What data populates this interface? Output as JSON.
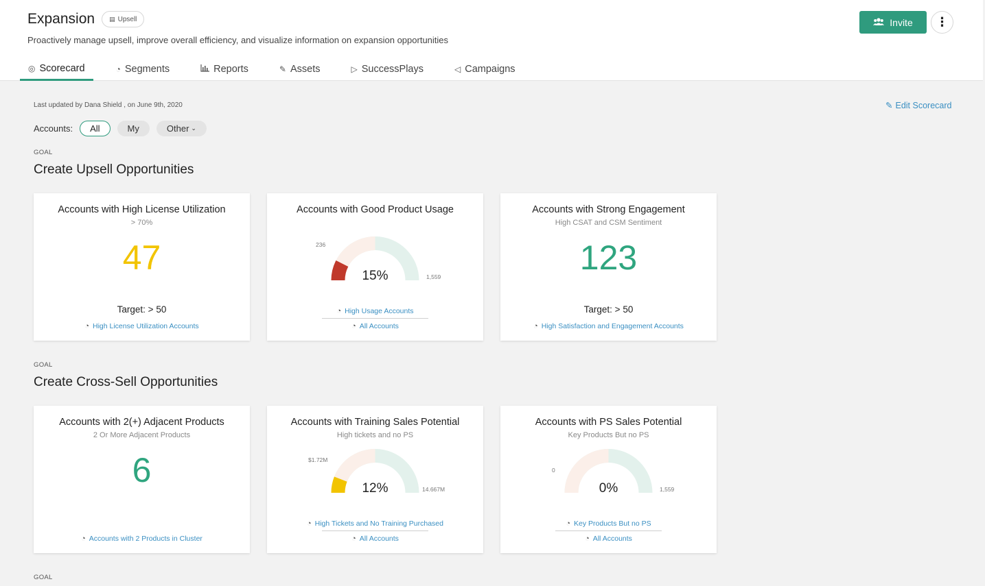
{
  "header": {
    "title": "Expansion",
    "chip": "Upsell",
    "subtitle": "Proactively manage upsell, improve overall efficiency, and visualize information on expansion opportunities",
    "invite_label": "Invite",
    "more_label": "⋮"
  },
  "tabs": [
    {
      "label": "Scorecard",
      "icon": "scorecard-icon",
      "active": true
    },
    {
      "label": "Segments",
      "icon": "pie-icon",
      "active": false
    },
    {
      "label": "Reports",
      "icon": "bar-chart-icon",
      "active": false
    },
    {
      "label": "Assets",
      "icon": "paperclip-icon",
      "active": false
    },
    {
      "label": "SuccessPlays",
      "icon": "play-icon",
      "active": false
    },
    {
      "label": "Campaigns",
      "icon": "megaphone-icon",
      "active": false
    }
  ],
  "toolbar": {
    "last_updated": "Last updated by Dana Shield , on June 9th, 2020",
    "edit_label": "Edit Scorecard",
    "accounts_label": "Accounts:",
    "filters": [
      "All",
      "My",
      "Other"
    ]
  },
  "goals": [
    {
      "label": "GOAL",
      "title": "Create Upsell Opportunities",
      "cards": [
        {
          "title": "Accounts with High License Utilization",
          "subtitle": "> 70%",
          "value": "47",
          "value_color": "#f2c400",
          "target": "Target: > 50",
          "links": [
            "High License Utilization Accounts"
          ]
        },
        {
          "title": "Accounts with Good Product Usage",
          "subtitle": "",
          "gauge": {
            "percent": "15%",
            "fraction": 0.15,
            "min": "236",
            "max": "1,559",
            "fill_color": "#c0392b"
          },
          "links": [
            "High Usage Accounts",
            "All Accounts"
          ]
        },
        {
          "title": "Accounts with Strong Engagement",
          "subtitle": "High CSAT and CSM Sentiment",
          "value": "123",
          "value_color": "#2fa57f",
          "target": "Target: > 50",
          "links": [
            "High Satisfaction and Engagement Accounts"
          ]
        }
      ]
    },
    {
      "label": "GOAL",
      "title": "Create Cross-Sell Opportunities",
      "cards": [
        {
          "title": "Accounts with 2(+) Adjacent Products",
          "subtitle": "2 Or More Adjacent Products",
          "value": "6",
          "value_color": "#2fa57f",
          "target": "",
          "links": [
            "Accounts with 2 Products in Cluster"
          ]
        },
        {
          "title": "Accounts with Training Sales Potential",
          "subtitle": "High tickets and no PS",
          "gauge": {
            "percent": "12%",
            "fraction": 0.12,
            "min": "$1.72M",
            "max": "14.667M",
            "fill_color": "#f2c400"
          },
          "links": [
            "High Tickets and No Training Purchased",
            "All Accounts"
          ]
        },
        {
          "title": "Accounts with PS Sales Potential",
          "subtitle": "Key Products But no PS",
          "gauge": {
            "percent": "0%",
            "fraction": 0.0,
            "min": "0",
            "max": "1,559",
            "fill_color": "#c0392b"
          },
          "links": [
            "Key Products But no PS",
            "All Accounts"
          ]
        }
      ]
    },
    {
      "label": "GOAL"
    }
  ]
}
